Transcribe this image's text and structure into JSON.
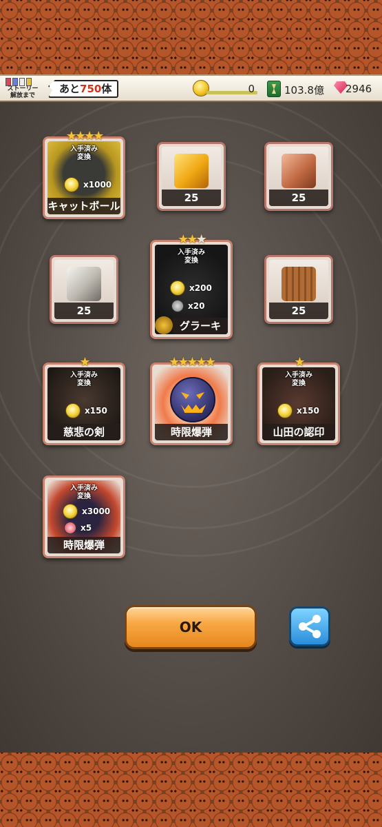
{
  "header": {
    "story_label": "ストーリー\n解放まで",
    "remain_prefix": "あと",
    "remain_count": "750",
    "remain_suffix": "体",
    "cat_food": "0",
    "xp": "103.8億",
    "gems": "2946"
  },
  "tiles": {
    "catball": {
      "got": "入手済み\n変換",
      "cost": "x1000",
      "label": "キャットボール",
      "stars": 4
    },
    "gold": {
      "label": "25"
    },
    "copper": {
      "label": "25"
    },
    "stone": {
      "label": "25"
    },
    "grarki": {
      "got": "入手済み\n変換",
      "cost1": "x200",
      "cost2": "x20",
      "label": "グラーキ",
      "stars": 3
    },
    "wood": {
      "label": "25"
    },
    "sword": {
      "got": "入手済み\n変換",
      "cost": "x150",
      "label": "慈悲の剣",
      "stars": 1
    },
    "bomb": {
      "label": "時限爆弾",
      "stars": 5
    },
    "seal": {
      "got": "入手済み\n変換",
      "cost": "x150",
      "label": "山田の認印",
      "stars": 1
    },
    "bomb2": {
      "got": "入手済み\n変換",
      "cost1": "x3000",
      "cost2": "x5",
      "label": "時限爆弾"
    }
  },
  "buttons": {
    "ok": "OK"
  },
  "colors": {
    "accent": "#e6861d",
    "share": "#2a8edb",
    "remain_number": "#d0321a"
  }
}
